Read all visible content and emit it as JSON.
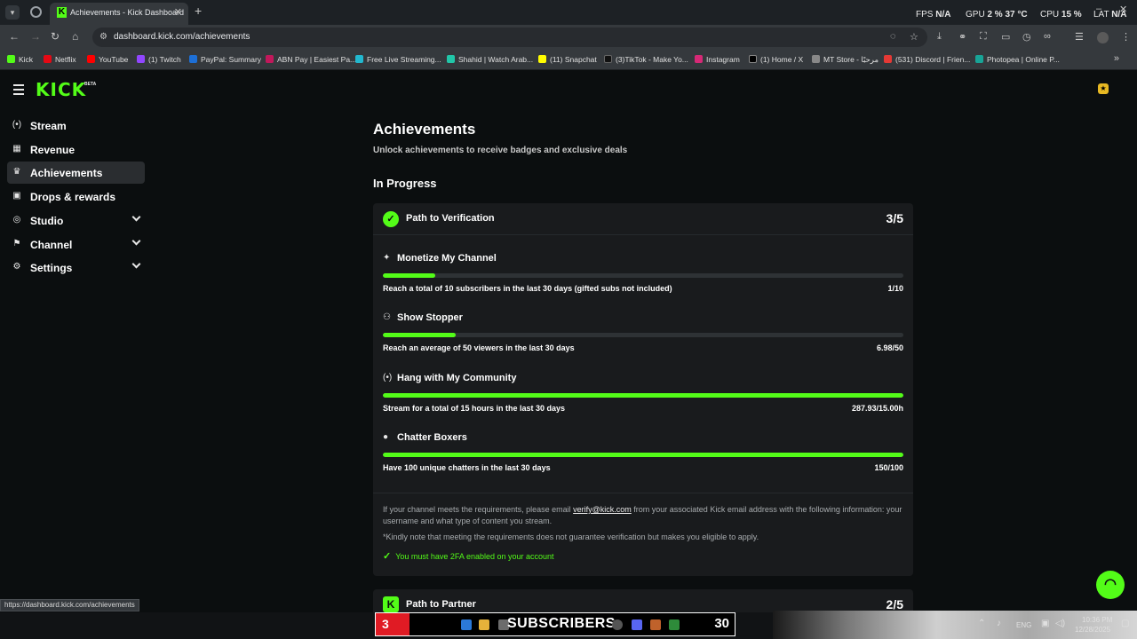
{
  "browser": {
    "tab_title": "Achievements - Kick Dashboard",
    "favicon_letter": "K",
    "url": "dashboard.kick.com/achievements",
    "status_url": "https://dashboard.kick.com/achievements",
    "perf": {
      "fps_label": "FPS",
      "fps_value": "N/A",
      "gpu_label": "GPU",
      "gpu_value": "2 %",
      "gpu_temp": "37 °C",
      "cpu_label": "CPU",
      "cpu_value": "15 %",
      "lat_label": "LAT",
      "lat_value": "N/A"
    },
    "bookmarks": [
      {
        "label": "Kick",
        "color": "#53fc18"
      },
      {
        "label": "Netflix",
        "color": "#e50914"
      },
      {
        "label": "YouTube",
        "color": "#ff0000"
      },
      {
        "label": "(1) Twitch",
        "color": "#9146ff"
      },
      {
        "label": "PayPal: Summary",
        "color": "#1d6fd6"
      },
      {
        "label": "ABN Pay | Easiest Pa...",
        "color": "#c2185b"
      },
      {
        "label": "Free Live Streaming...",
        "color": "#22b8cf"
      },
      {
        "label": "Shahid | Watch Arab...",
        "color": "#21c6a8"
      },
      {
        "label": "(11) Snapchat",
        "color": "#fffc00"
      },
      {
        "label": "(3)TikTok - Make Yo...",
        "color": "#111111"
      },
      {
        "label": "Instagram",
        "color": "#d62976"
      },
      {
        "label": "(1) Home / X",
        "color": "#000000"
      },
      {
        "label": "MT Store - مرحبًا",
        "color": "#888888"
      },
      {
        "label": "(531) Discord | Frien...",
        "color": "#e53935"
      },
      {
        "label": "Photopea | Online P...",
        "color": "#18a497"
      }
    ]
  },
  "app": {
    "logo": "KICK",
    "logo_badge": "BETA",
    "sidebar": [
      {
        "label": "Stream",
        "icon": "broadcast-icon",
        "glyph": "(•)"
      },
      {
        "label": "Revenue",
        "icon": "revenue-icon",
        "glyph": "▦"
      },
      {
        "label": "Achievements",
        "icon": "trophy-icon",
        "glyph": "🏆"
      },
      {
        "label": "Drops & rewards",
        "icon": "gift-icon",
        "glyph": "▣"
      },
      {
        "label": "Studio",
        "icon": "studio-icon",
        "glyph": "◎"
      },
      {
        "label": "Channel",
        "icon": "channel-icon",
        "glyph": "⚑"
      },
      {
        "label": "Settings",
        "icon": "gear-icon",
        "glyph": "⚙"
      }
    ],
    "page_title": "Achievements",
    "page_subtitle": "Unlock achievements to receive badges and exclusive deals",
    "section_title": "In Progress",
    "verification": {
      "title": "Path to Verification",
      "count": "3/5",
      "items": [
        {
          "title": "Monetize My Channel",
          "icon": "sparkle-icon",
          "glyph": "✦",
          "desc": "Reach a total of 10 subscribers in the last 30 days (gifted subs not included)",
          "value": "1/10",
          "progress": 0.1
        },
        {
          "title": "Show Stopper",
          "icon": "viewers-icon",
          "glyph": "⚇",
          "desc": "Reach an average of 50 viewers in the last 30 days",
          "value": "6.98/50",
          "progress": 0.14
        },
        {
          "title": "Hang with My Community",
          "icon": "broadcast-icon",
          "glyph": "(•)",
          "desc": "Stream for a total of 15 hours in the last 30 days",
          "value": "287.93/15.00h",
          "progress": 1.0
        },
        {
          "title": "Chatter Boxers",
          "icon": "chat-bubble-icon",
          "glyph": "●",
          "desc": "Have 100 unique chatters in the last 30 days",
          "value": "150/100",
          "progress": 1.0
        }
      ],
      "info_before": "If your channel meets the requirements, please email ",
      "info_email": "verify@kick.com",
      "info_after": " from your associated Kick email address with the following information: your username and what type of content you stream.",
      "note": "*Kindly note that meeting the requirements does not guarantee verification but makes you eligible to apply.",
      "requirement": "You must have 2FA enabled on your account"
    },
    "partner": {
      "title": "Path to Partner",
      "count": "2/5"
    }
  },
  "taskbar": {
    "sub_count": "3",
    "sub_label": "SUBSCRIBERS",
    "sub_goal": "30",
    "language": "ENG",
    "time": "10:36 PM",
    "date": "12/28/2025"
  }
}
